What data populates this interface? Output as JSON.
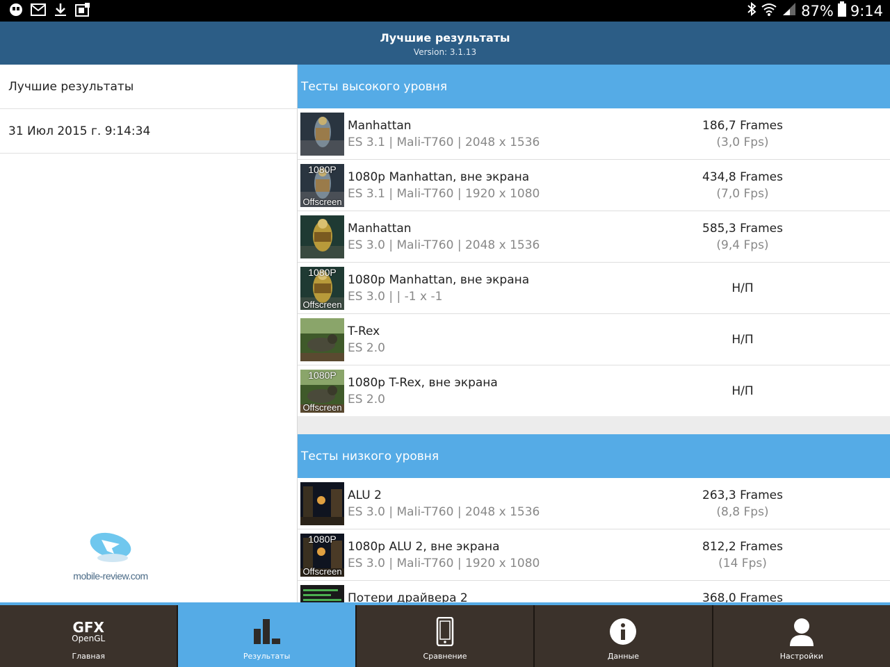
{
  "status_bar": {
    "battery": "87%",
    "time": "9:14",
    "left_icons": [
      "hangouts-icon",
      "gmail-icon",
      "download-icon",
      "screenshot-icon"
    ],
    "right_icons": [
      "bluetooth-icon",
      "wifi-icon",
      "signal-icon",
      "battery-icon"
    ]
  },
  "header": {
    "title": "Лучшие результаты",
    "version": "Version: 3.1.13"
  },
  "left_panel": {
    "items": [
      {
        "label": "Лучшие результаты"
      },
      {
        "label": "31 Июл 2015 г. 9:14:34"
      }
    ],
    "logo_text": "mobile-review.com"
  },
  "sections": [
    {
      "title": "Тесты высокого уровня",
      "rows": [
        {
          "name": "Manhattan",
          "sub": "ES 3.1 | Mali-T760 | 2048 x 1536",
          "score": "186,7 Frames",
          "fps": "(3,0 Fps)",
          "thumb": "manhattan"
        },
        {
          "name": "1080p Manhattan, вне экрана",
          "sub": "ES 3.1 | Mali-T760 | 1920 x 1080",
          "score": "434,8 Frames",
          "fps": "(7,0 Fps)",
          "thumb": "manhattan",
          "badge_top": "1080P",
          "badge_bot": "Offscreen"
        },
        {
          "name": "Manhattan",
          "sub": "ES 3.0 | Mali-T760 | 2048 x 1536",
          "score": "585,3 Frames",
          "fps": "(9,4 Fps)",
          "thumb": "manhattan-gold"
        },
        {
          "name": "1080p Manhattan, вне экрана",
          "sub": "ES 3.0 |  | -1 x -1",
          "na": "Н/П",
          "thumb": "manhattan-gold",
          "badge_top": "1080P",
          "badge_bot": "Offscreen"
        },
        {
          "name": "T-Rex",
          "sub": "ES 2.0",
          "na": "Н/П",
          "thumb": "trex"
        },
        {
          "name": "1080p T-Rex, вне экрана",
          "sub": "ES 2.0",
          "na": "Н/П",
          "thumb": "trex",
          "badge_top": "1080P",
          "badge_bot": "Offscreen"
        }
      ]
    },
    {
      "title": "Тесты низкого уровня",
      "rows": [
        {
          "name": "ALU 2",
          "sub": "ES 3.0 | Mali-T760 | 2048 x 1536",
          "score": "263,3 Frames",
          "fps": "(8,8 Fps)",
          "thumb": "alu"
        },
        {
          "name": "1080p ALU 2, вне экрана",
          "sub": "ES 3.0 | Mali-T760 | 1920 x 1080",
          "score": "812,2 Frames",
          "fps": "(14 Fps)",
          "thumb": "alu",
          "badge_top": "1080P",
          "badge_bot": "Offscreen"
        },
        {
          "name": "Потери драйвера 2",
          "sub": "",
          "score": "368,0 Frames",
          "fps": "",
          "thumb": "driver"
        }
      ]
    }
  ],
  "bottom_nav": [
    {
      "label": "Главная",
      "icon": "gfx-opengl-logo-icon",
      "logo_line1": "GFX",
      "logo_line2": "OpenGL"
    },
    {
      "label": "Результаты",
      "icon": "bar-chart-icon",
      "active": true
    },
    {
      "label": "Сравнение",
      "icon": "phone-icon"
    },
    {
      "label": "Данные",
      "icon": "info-icon"
    },
    {
      "label": "Настройки",
      "icon": "user-icon"
    }
  ],
  "colors": {
    "header": "#2c5d86",
    "accent": "#55abe6",
    "nav_bg": "#3b322b"
  }
}
